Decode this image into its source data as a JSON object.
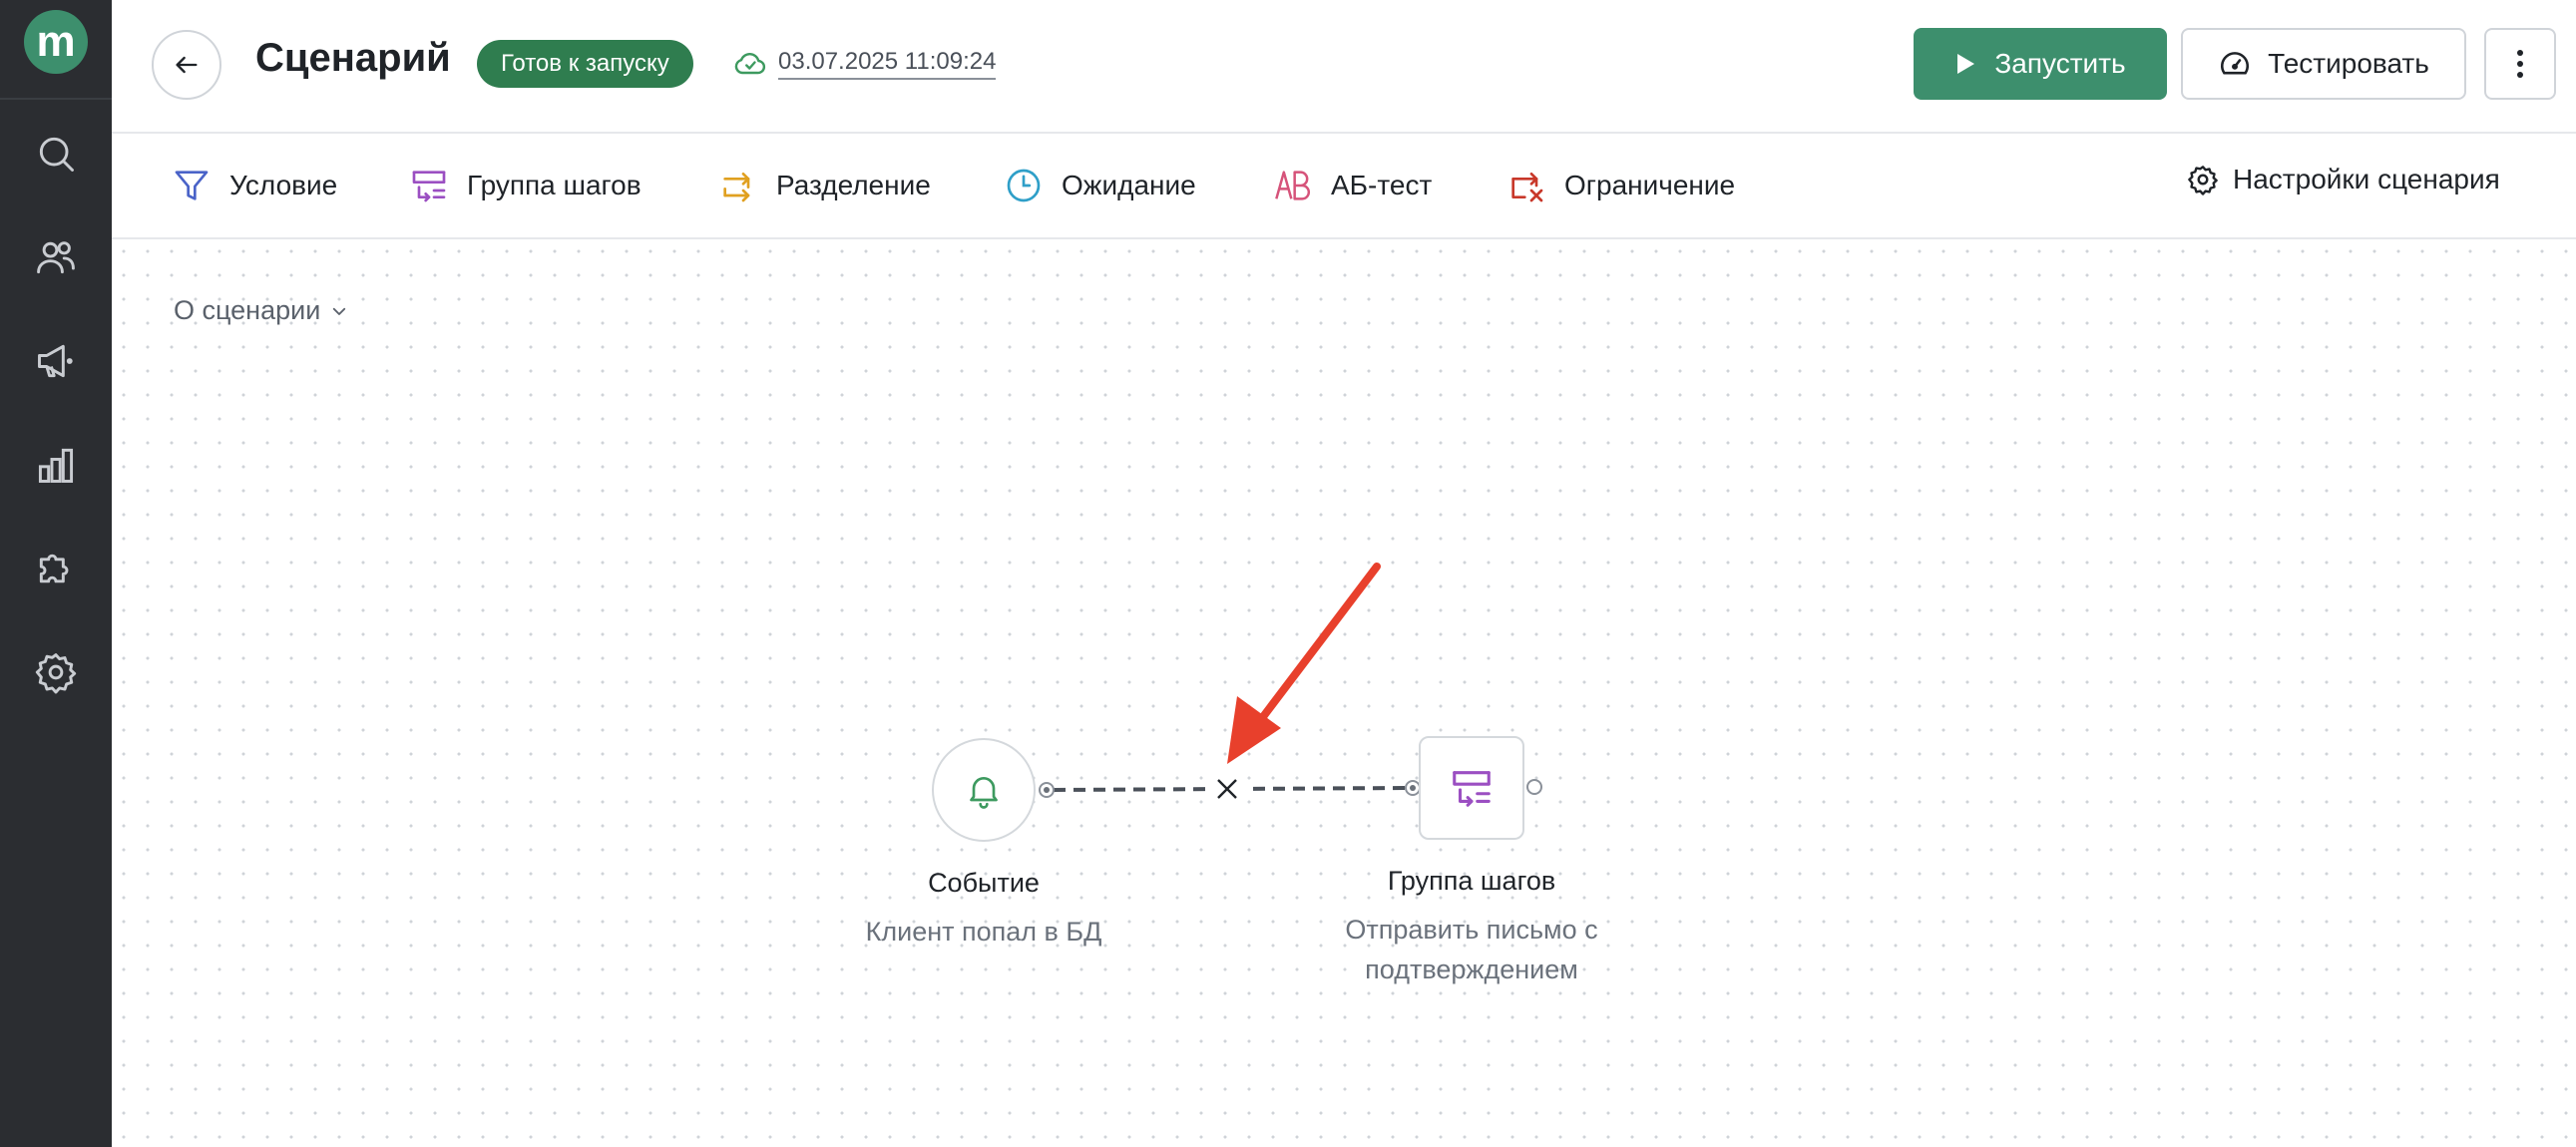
{
  "sidebar": {
    "logo": "m",
    "items": [
      {
        "icon": "search-icon"
      },
      {
        "icon": "users-icon"
      },
      {
        "icon": "megaphone-icon"
      },
      {
        "icon": "analytics-icon"
      },
      {
        "icon": "puzzle-icon"
      },
      {
        "icon": "gear-icon"
      }
    ]
  },
  "header": {
    "title": "Сценарий",
    "status": "Готов к запуску",
    "saved_at": "03.07.2025 11:09:24",
    "run_label": "Запустить",
    "test_label": "Тестировать"
  },
  "toolbar": {
    "items": [
      {
        "label": "Условие",
        "icon": "filter-icon",
        "color": "#4a63c8"
      },
      {
        "label": "Группа шагов",
        "icon": "step-group-icon",
        "color": "#9b4fc2"
      },
      {
        "label": "Разделение",
        "icon": "split-icon",
        "color": "#e0a020"
      },
      {
        "label": "Ожидание",
        "icon": "clock-icon",
        "color": "#2f9fc8"
      },
      {
        "label": "АБ-тест",
        "icon": "ab-test-icon",
        "color": "#d6537a"
      },
      {
        "label": "Ограничение",
        "icon": "limit-icon",
        "color": "#c8382a"
      }
    ],
    "settings_label": "Настройки сценария"
  },
  "canvas": {
    "about_label": "О сценарии",
    "nodes": [
      {
        "title": "Событие",
        "subtitle": "Клиент попал в БД",
        "icon": "bell-icon",
        "color": "#3d9a5f"
      },
      {
        "title": "Группа шагов",
        "subtitle_line1": "Отправить письмо с",
        "subtitle_line2": "подтверждением",
        "icon": "step-group-icon",
        "color": "#9b4fc2"
      }
    ],
    "edge_delete_icon": "close-icon",
    "annotation_color": "#e8402c"
  },
  "colors": {
    "brand": "#3d8f6d",
    "sidebar_bg": "#2b2d31",
    "status_bg": "#2f7d4f"
  }
}
